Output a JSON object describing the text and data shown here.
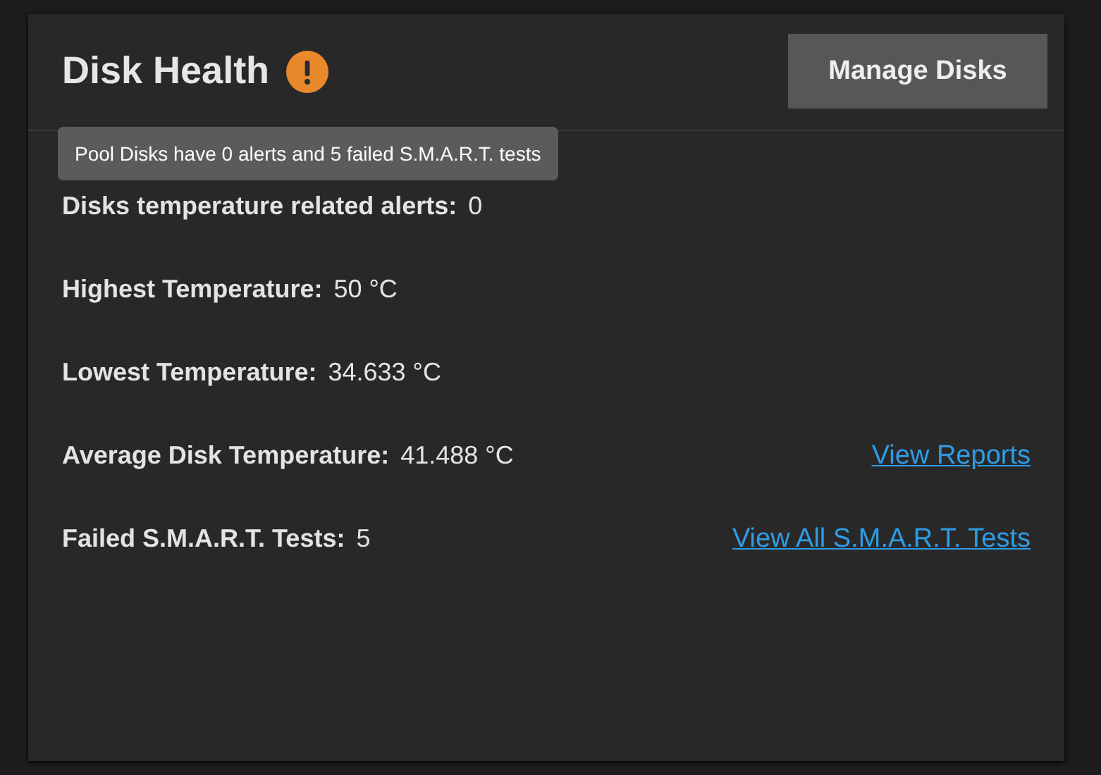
{
  "card": {
    "title": "Disk Health",
    "warning": true,
    "button": "Manage Disks"
  },
  "tooltip": "Pool Disks have 0 alerts and 5 failed S.M.A.R.T. tests",
  "rows": [
    {
      "label": "Disks temperature related alerts:",
      "value": "0"
    },
    {
      "label": "Highest Temperature:",
      "value": "50 °C"
    },
    {
      "label": "Lowest Temperature:",
      "value": "34.633 °C"
    },
    {
      "label": "Average Disk Temperature:",
      "value": "41.488 °C",
      "link": "View Reports"
    },
    {
      "label": "Failed S.M.A.R.T. Tests:",
      "value": "5",
      "link": "View All S.M.A.R.T. Tests"
    }
  ]
}
